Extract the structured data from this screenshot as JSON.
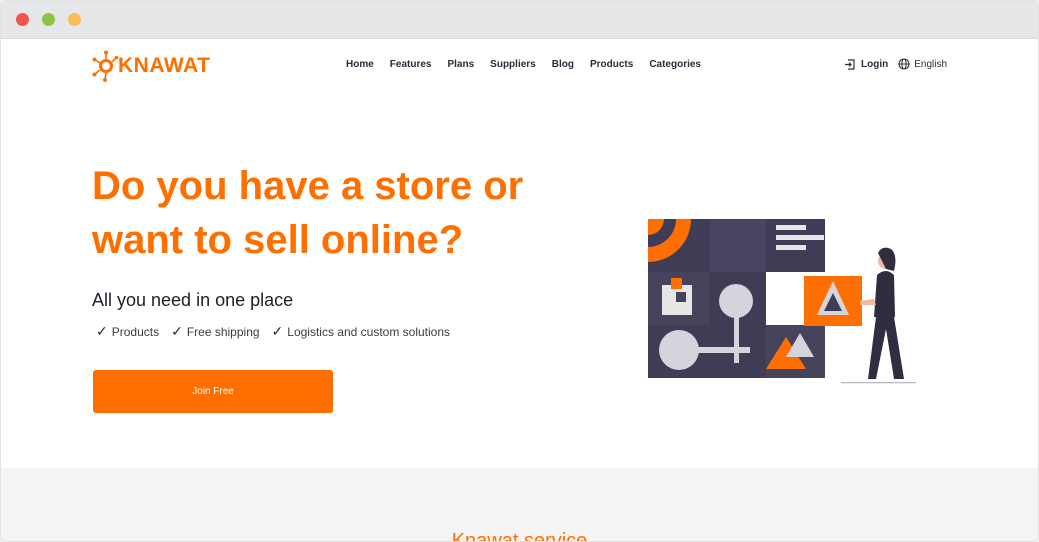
{
  "brand": {
    "name": "KNAWAT",
    "accent": "#ff6f00"
  },
  "nav": {
    "links": [
      "Home",
      "Features",
      "Plans",
      "Suppliers",
      "Blog",
      "Products",
      "Categories"
    ],
    "login_label": "Login",
    "language_label": "English"
  },
  "hero": {
    "title": "Do you have a store or want to sell online?",
    "subtitle": "All you need in one place",
    "features": [
      "Products",
      "Free shipping",
      "Logistics and custom solutions"
    ],
    "cta_label": "Join Free"
  },
  "section": {
    "heading": "Knawat service"
  }
}
